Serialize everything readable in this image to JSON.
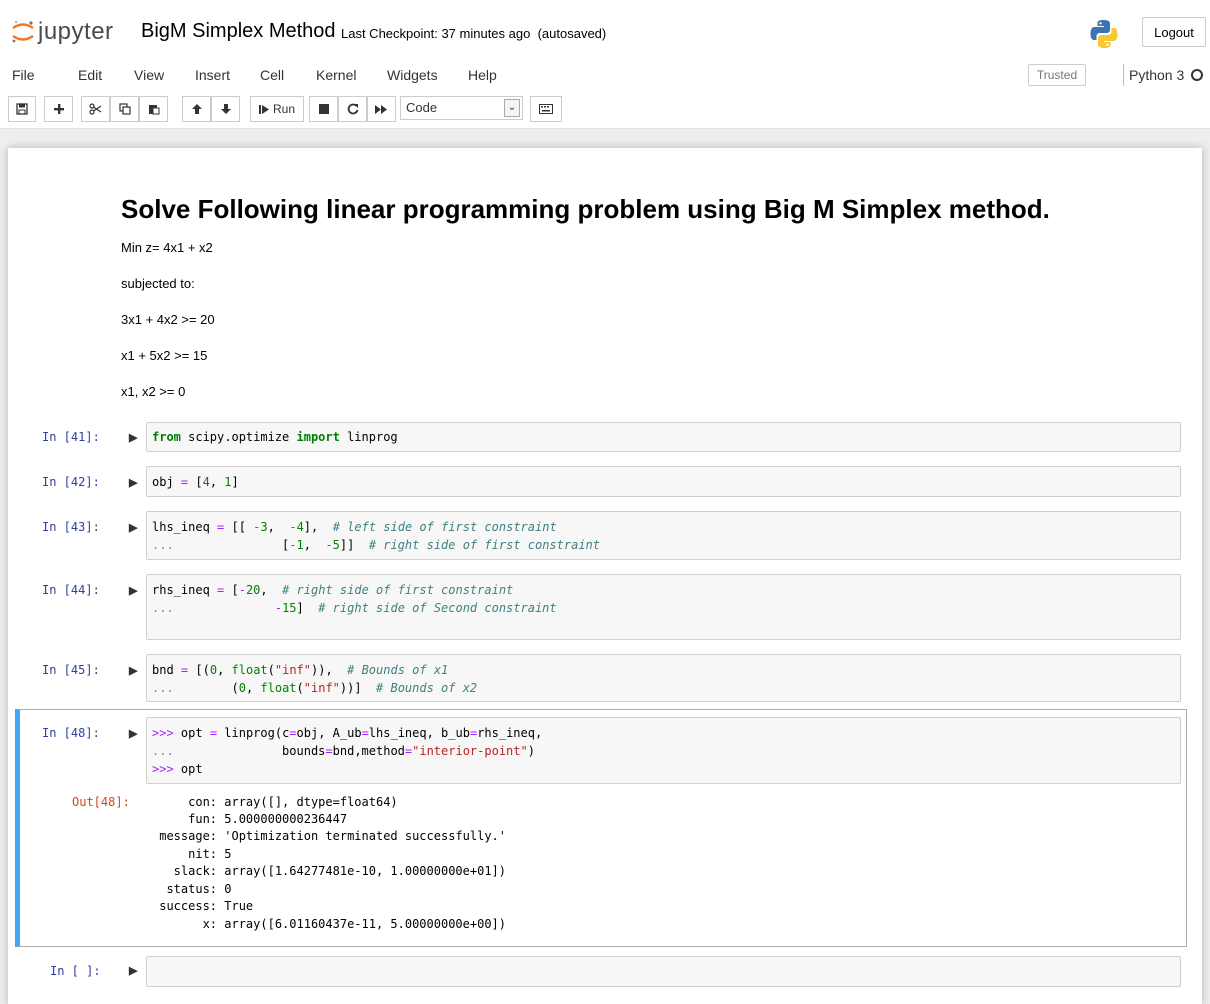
{
  "header": {
    "brand": "jupyter",
    "notebook_name": "BigM Simplex Method",
    "checkpoint": "Last Checkpoint: 37 minutes ago",
    "autosaved": "(autosaved)",
    "logout_label": "Logout",
    "python_logo_icon": "python-logo-icon"
  },
  "menu": {
    "items": [
      "File",
      "Edit",
      "View",
      "Insert",
      "Cell",
      "Kernel",
      "Widgets",
      "Help"
    ],
    "trusted": "Trusted",
    "kernel": "Python 3"
  },
  "toolbar": {
    "icons": [
      "save-icon",
      "plus-icon",
      "cut-icon",
      "copy-icon",
      "paste-icon",
      "arrow-up-icon",
      "arrow-down-icon",
      "run-icon",
      "stop-icon",
      "restart-icon",
      "fast-forward-icon",
      "keyboard-icon"
    ],
    "run_label": "Run",
    "cell_type": "Code"
  },
  "markdown": {
    "heading": "Solve Following linear programming problem using Big M Simplex method.",
    "lines": [
      "Min z= 4x1 + x2",
      "subjected to:",
      "3x1 + 4x2 >= 20",
      "x1 + 5x2 >= 15",
      "x1, x2 >= 0"
    ]
  },
  "cells": [
    {
      "prompt": "In [41]:",
      "lines": [
        "from scipy.optimize import linprog"
      ]
    },
    {
      "prompt": "In [42]:",
      "lines": [
        "obj = [4, 1]"
      ]
    },
    {
      "prompt": "In [43]:",
      "lines": [
        "lhs_ineq = [[ -3,  -4],  # left side of first constraint",
        "...               [-1,  -5]]  # right side of first constraint"
      ]
    },
    {
      "prompt": "In [44]:",
      "lines": [
        "rhs_ineq = [-20,  # right side of first constraint",
        "...              -15]  # right side of Second constraint"
      ]
    },
    {
      "prompt": "In [45]:",
      "lines": [
        "bnd = [(0, float(\"inf\")),  # Bounds of x1",
        "...        (0, float(\"inf\"))]  # Bounds of x2"
      ]
    },
    {
      "prompt": "In [48]:",
      "lines": [
        ">>> opt = linprog(c=obj, A_ub=lhs_ineq, b_ub=rhs_ineq,",
        "...               bounds=bnd,method=\"interior-point\")",
        ">>> opt"
      ]
    },
    {
      "prompt": "In [ ]:",
      "lines": []
    }
  ],
  "output": {
    "prompt": "Out[48]:",
    "lines": [
      "     con: array([], dtype=float64)",
      "     fun: 5.000000000236447",
      " message: 'Optimization terminated successfully.'",
      "     nit: 5",
      "   slack: array([1.64277481e-10, 1.00000000e+01])",
      "  status: 0",
      " success: True",
      "       x: array([6.01160437e-11, 5.00000000e+00])"
    ]
  }
}
